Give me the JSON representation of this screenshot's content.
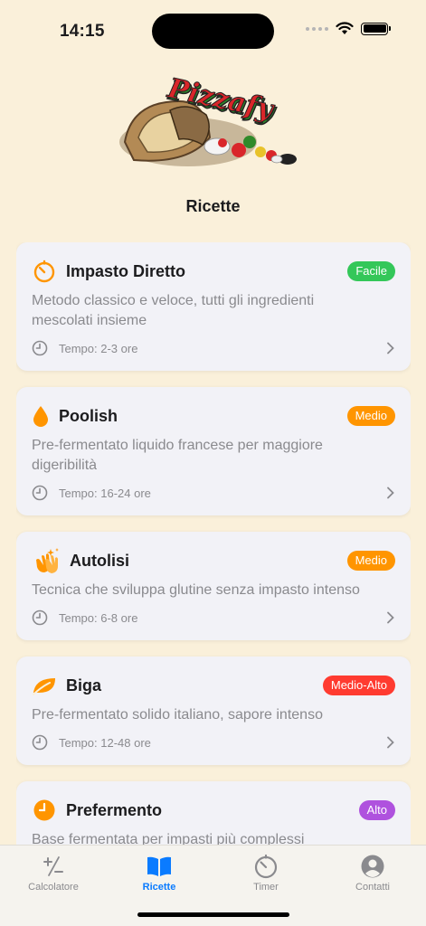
{
  "status": {
    "time": "14:15"
  },
  "header": {
    "logo_text": "Pizzafy",
    "title": "Ricette"
  },
  "recipes": [
    {
      "icon": "timer-icon",
      "title": "Impasto Diretto",
      "badge": "Facile",
      "badge_color": "#34C759",
      "description": "Metodo classico e veloce, tutti gli ingredienti mescolati insieme",
      "time": "Tempo: 2-3 ore"
    },
    {
      "icon": "drop-icon",
      "title": "Poolish",
      "badge": "Medio",
      "badge_color": "#FF9500",
      "description": "Pre-fermentato liquido francese per maggiore digeribilità",
      "time": "Tempo: 16-24 ore"
    },
    {
      "icon": "hands-sparkles-icon",
      "title": "Autolisi",
      "badge": "Medio",
      "badge_color": "#FF9500",
      "description": "Tecnica che sviluppa glutine senza impasto intenso",
      "time": "Tempo: 6-8 ore"
    },
    {
      "icon": "leaf-icon",
      "title": "Biga",
      "badge": "Medio-Alto",
      "badge_color": "#FF3B30",
      "description": "Pre-fermentato solido italiano, sapore intenso",
      "time": "Tempo: 12-48 ore"
    },
    {
      "icon": "clock-fill-icon",
      "title": "Prefermento",
      "badge": "Alto",
      "badge_color": "#AF52DE",
      "description": "Base fermentata per impasti più complessi",
      "time": ""
    }
  ],
  "tabs": [
    {
      "label": "Calcolatore",
      "icon": "plus-minus-icon",
      "active": false
    },
    {
      "label": "Ricette",
      "icon": "book-icon",
      "active": true
    },
    {
      "label": "Timer",
      "icon": "timer-icon",
      "active": false
    },
    {
      "label": "Contatti",
      "icon": "person-circle-icon",
      "active": false
    }
  ],
  "colors": {
    "background": "#FAF0DA",
    "accent": "#0A7BFF",
    "orange": "#FF9500"
  }
}
